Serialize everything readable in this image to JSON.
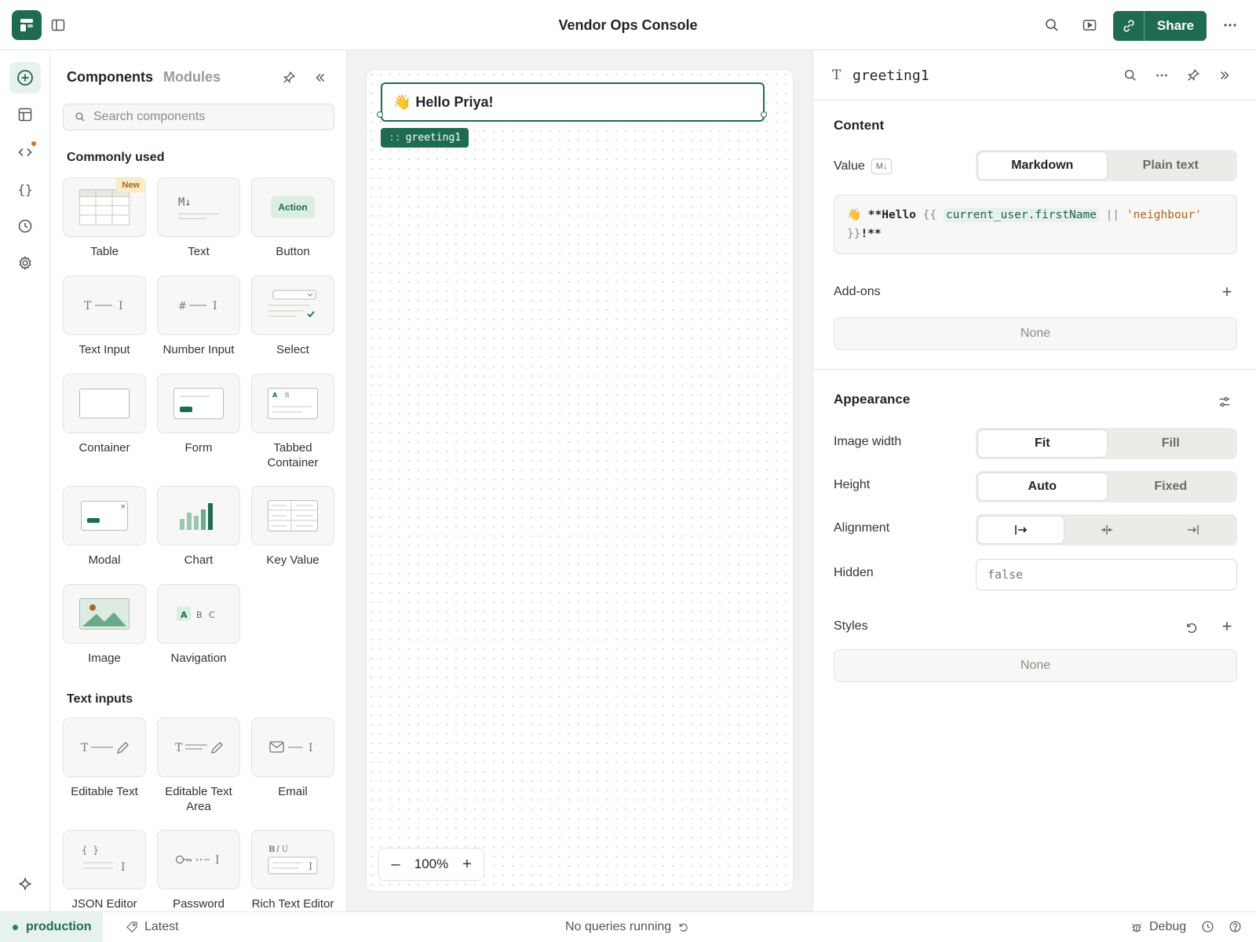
{
  "app": {
    "title": "Vendor Ops Console",
    "share_label": "Share"
  },
  "components_panel": {
    "tabs": [
      "Components",
      "Modules"
    ],
    "search_placeholder": "Search components",
    "sections": {
      "common": {
        "title": "Commonly used",
        "items": [
          {
            "label": "Table",
            "badge": "New",
            "icon": "table-icon"
          },
          {
            "label": "Text",
            "icon": "text-markdown-icon",
            "glyph": "M↓"
          },
          {
            "label": "Button",
            "icon": "button-icon",
            "glyph": "Action"
          },
          {
            "label": "Text Input",
            "icon": "text-input-icon"
          },
          {
            "label": "Number Input",
            "icon": "number-input-icon"
          },
          {
            "label": "Select",
            "icon": "select-icon"
          },
          {
            "label": "Container",
            "icon": "container-icon"
          },
          {
            "label": "Form",
            "icon": "form-icon"
          },
          {
            "label": "Tabbed Container",
            "icon": "tabbed-container-icon"
          },
          {
            "label": "Modal",
            "icon": "modal-icon"
          },
          {
            "label": "Chart",
            "icon": "chart-icon"
          },
          {
            "label": "Key Value",
            "icon": "key-value-icon"
          },
          {
            "label": "Image",
            "icon": "image-icon"
          },
          {
            "label": "Navigation",
            "icon": "navigation-icon"
          }
        ]
      },
      "text_inputs": {
        "title": "Text inputs",
        "items": [
          {
            "label": "Editable Text",
            "icon": "editable-text-icon"
          },
          {
            "label": "Editable Text Area",
            "icon": "editable-text-area-icon"
          },
          {
            "label": "Email",
            "icon": "email-icon"
          },
          {
            "label": "JSON Editor",
            "icon": "json-editor-icon"
          },
          {
            "label": "Password",
            "icon": "password-icon"
          },
          {
            "label": "Rich Text Editor",
            "icon": "rich-text-editor-icon"
          }
        ]
      }
    }
  },
  "canvas": {
    "greeting_text": "Hello Priya!",
    "greeting_emoji": "👋",
    "component_tag": "greeting1",
    "zoom": "100%"
  },
  "inspector": {
    "component_name": "greeting1",
    "content": {
      "title": "Content",
      "value_label": "Value",
      "value_badge": "M↓",
      "mode_options": [
        "Markdown",
        "Plain text"
      ],
      "mode_selected": "Markdown",
      "code": {
        "emoji": "👋",
        "bold_open": "**Hello",
        "brace_open": "{{",
        "var": "current_user.firstName",
        "op": "||",
        "str": "'neighbour'",
        "brace_close": "}}",
        "tail": "!**"
      },
      "addons_label": "Add-ons",
      "addons_value": "None"
    },
    "appearance": {
      "title": "Appearance",
      "image_width_label": "Image width",
      "image_width_options": [
        "Fit",
        "Fill"
      ],
      "image_width_selected": "Fit",
      "height_label": "Height",
      "height_options": [
        "Auto",
        "Fixed"
      ],
      "height_selected": "Auto",
      "alignment_label": "Alignment",
      "alignment_options": [
        "left",
        "center",
        "right"
      ],
      "alignment_selected": "left",
      "hidden_label": "Hidden",
      "hidden_value": "false",
      "styles_label": "Styles",
      "styles_value": "None"
    }
  },
  "status_bar": {
    "environment": "production",
    "version": "Latest",
    "queries": "No queries running",
    "debug": "Debug"
  },
  "colors": {
    "accent": "#1f6b52",
    "accent_light": "#e8f2ec",
    "warning_dot": "#c77a2a"
  }
}
